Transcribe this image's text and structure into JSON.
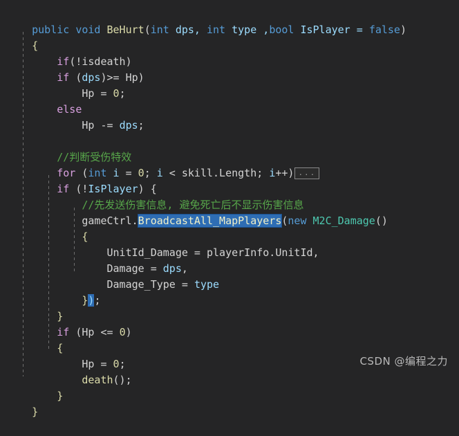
{
  "editor": {
    "language": "csharp",
    "theme": "visual-studio-dark",
    "background_color": "#252526",
    "selection_color": "#2e6db4",
    "comment_color": "#57a64a",
    "keyword_color": "#569cd6",
    "control_keyword_color": "#d8a0df",
    "method_color": "#dcdcaa",
    "type_color": "#4ec9b0",
    "parameter_color": "#9cdcfe",
    "text_color": "#d4d4d4"
  },
  "code": {
    "line_01": {
      "t1": "public",
      "t2": " ",
      "t3": "void",
      "t4": " ",
      "t5": "BeHurt",
      "t6": "(",
      "t7": "int",
      "t8": " dps, ",
      "t9": "int",
      "t10": " type ,",
      "t11": "bool",
      "t12": " IsPlayer = ",
      "t13": "false",
      "t14": ")"
    },
    "line_02": {
      "t1": "{"
    },
    "line_03": {
      "t1": "    ",
      "t2": "if",
      "t3": "(!isdeath)"
    },
    "line_04": {
      "t1": "    ",
      "t2": "if",
      "t3": " (",
      "t4": "dps",
      "t5": ")>= Hp)"
    },
    "line_05": {
      "t1": "        Hp = ",
      "t2": "0",
      "t3": ";"
    },
    "line_06": {
      "t1": "    ",
      "t2": "else"
    },
    "line_07": {
      "t1": "        Hp -= ",
      "t2": "dps",
      "t3": ";"
    },
    "line_08": {
      "t1": ""
    },
    "line_09": {
      "t1": "    ",
      "t2": "//判断受伤特效"
    },
    "line_10": {
      "t1": "    ",
      "t2": "for",
      "t3": " (",
      "t4": "int",
      "t5": " ",
      "t6": "i",
      "t7": " = ",
      "t8": "0",
      "t9": "; ",
      "t10": "i",
      "t11": " < skill.Length; ",
      "t12": "i",
      "t13": "++)",
      "t14": "..."
    },
    "line_11": {
      "t1": "    ",
      "t2": "if",
      "t3": " (!",
      "t4": "IsPlayer",
      "t5": ") {"
    },
    "line_12": {
      "t1": "        ",
      "t2": "//先发送伤害信息, 避免死亡后不显示伤害信息"
    },
    "line_13": {
      "t1": "        gameCtrl.",
      "t2": "BroadcastAll_MapPlayers",
      "t3": "(",
      "t4": "new",
      "t5": " ",
      "t6": "M2C_Damage",
      "t7": "()"
    },
    "line_14": {
      "t1": "        {"
    },
    "line_15": {
      "t1": "            UnitId_Damage = playerInfo.UnitId,"
    },
    "line_16": {
      "t1": "            Damage = ",
      "t2": "dps",
      "t3": ","
    },
    "line_17": {
      "t1": "            Damage_Type = ",
      "t2": "type"
    },
    "line_18": {
      "t1": "        }",
      "t2": ")",
      "t3": ";"
    },
    "line_19": {
      "t1": "    }"
    },
    "line_20": {
      "t1": "    ",
      "t2": "if",
      "t3": " (Hp <= ",
      "t4": "0",
      "t5": ")"
    },
    "line_21": {
      "t1": "    {"
    },
    "line_22": {
      "t1": "        Hp = ",
      "t2": "0",
      "t3": ";"
    },
    "line_23": {
      "t1": "        ",
      "t2": "death",
      "t3": "();"
    },
    "line_24": {
      "t1": "    }"
    },
    "line_25": {
      "t1": "}"
    }
  },
  "watermark": {
    "text": "CSDN @编程之力"
  }
}
